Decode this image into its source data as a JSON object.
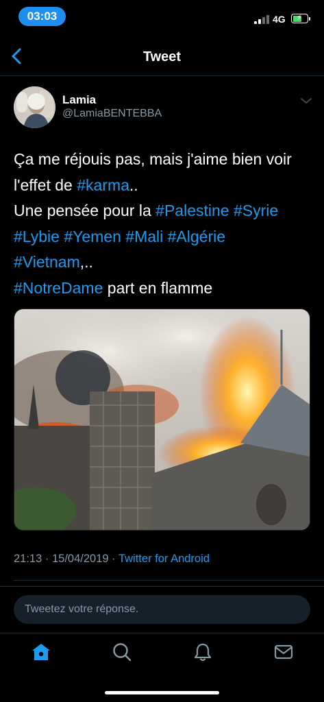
{
  "status_bar": {
    "time": "03:03",
    "network": "4G",
    "time_pill_color": "#1d8ff2",
    "battery_color": "#4cd964"
  },
  "nav": {
    "title": "Tweet",
    "back_icon": "chevron-left-icon"
  },
  "tweet": {
    "author_name": "Lamia",
    "author_handle": "@LamiaBENTEBBA",
    "text_lines": [
      [
        {
          "t": "Ça me réjouis pas, mais j'aime bien voir"
        }
      ],
      [
        {
          "t": "l'effet de "
        },
        {
          "t": "#karma",
          "tag": true
        },
        {
          "t": ".."
        }
      ],
      [
        {
          "t": "Une pensée pour la "
        },
        {
          "t": "#Palestine",
          "tag": true
        },
        {
          "t": " "
        },
        {
          "t": "#Syrie",
          "tag": true
        }
      ],
      [
        {
          "t": "#Lybie",
          "tag": true
        },
        {
          "t": " "
        },
        {
          "t": "#Yemen",
          "tag": true
        },
        {
          "t": " "
        },
        {
          "t": "#Mali",
          "tag": true
        },
        {
          "t": " "
        },
        {
          "t": "#Algérie",
          "tag": true
        }
      ],
      [
        {
          "t": "#Vietnam",
          "tag": true
        },
        {
          "t": ",.."
        }
      ],
      [
        {
          "t": "#NotreDame",
          "tag": true
        },
        {
          "t": " part en flamme"
        }
      ]
    ],
    "time": "21:13",
    "separator": "·",
    "date": "15/04/2019",
    "source": "Twitter for Android",
    "hashtag_color": "#1d9bf0"
  },
  "reply": {
    "placeholder": "Tweetez votre réponse."
  },
  "tab_bar": {
    "items": [
      "home-icon",
      "search-icon",
      "notifications-icon",
      "messages-icon"
    ],
    "active": "home-icon",
    "accent": "#1d9bf0"
  }
}
